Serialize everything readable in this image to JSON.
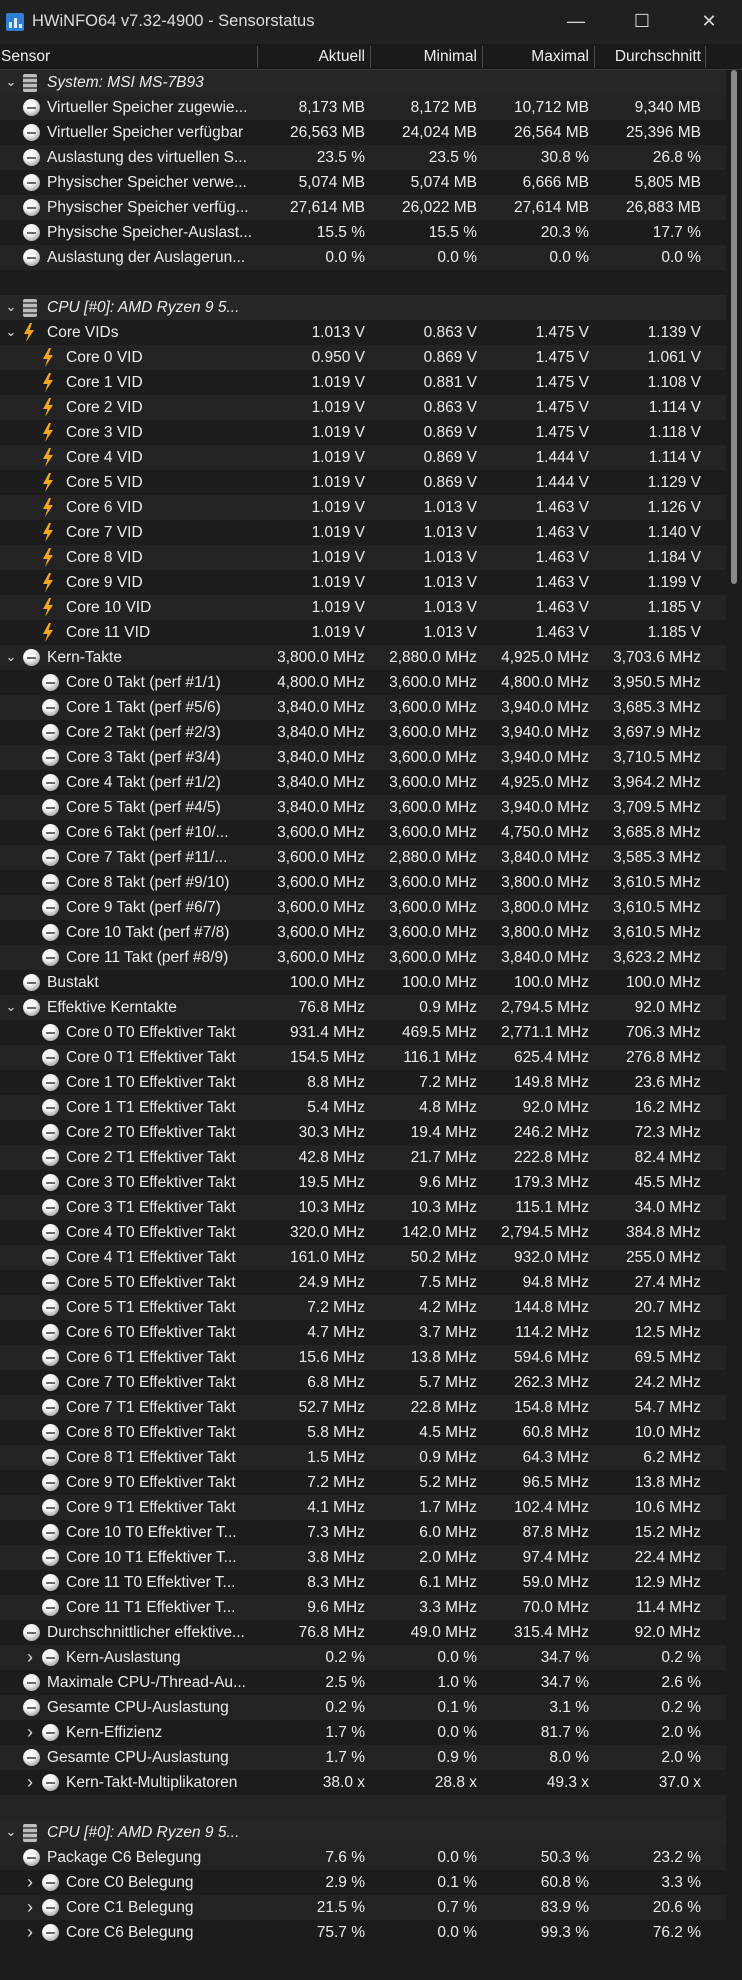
{
  "window": {
    "title": "HWiNFO64 v7.32-4900 - Sensorstatus",
    "minimize_glyph": "—",
    "maximize_glyph": "☐",
    "close_glyph": "✕",
    "icon": "hwinfo-app-icon"
  },
  "columns": {
    "sensor": "Sensor",
    "current": "Aktuell",
    "min": "Minimal",
    "max": "Maximal",
    "avg": "Durchschnitt"
  },
  "icons": {
    "expanded": "chevron-down-icon",
    "collapsed": "chevron-right-icon",
    "group": "chip-icon",
    "voltage": "lightning-bolt-icon",
    "value": "gauge-icon"
  },
  "colors": {
    "background": "#1c1c1c",
    "row_alt": "#232323",
    "text": "#ededed",
    "bolt": "#f3a81c"
  },
  "rows": [
    {
      "kind": "group",
      "chevron": "down",
      "icon": "chip",
      "level": 0,
      "name": "System: MSI MS-7B93",
      "values": [
        "",
        "",
        "",
        ""
      ]
    },
    {
      "kind": "item",
      "chevron": "none",
      "icon": "circle",
      "level": 0,
      "name": "Virtueller Speicher zugewie...",
      "values": [
        "8,173 MB",
        "8,172 MB",
        "10,712 MB",
        "9,340 MB"
      ]
    },
    {
      "kind": "item",
      "chevron": "none",
      "icon": "circle",
      "level": 0,
      "name": "Virtueller Speicher verfügbar",
      "values": [
        "26,563 MB",
        "24,024 MB",
        "26,564 MB",
        "25,396 MB"
      ]
    },
    {
      "kind": "item",
      "chevron": "none",
      "icon": "circle",
      "level": 0,
      "name": "Auslastung des virtuellen S...",
      "values": [
        "23.5 %",
        "23.5 %",
        "30.8 %",
        "26.8 %"
      ]
    },
    {
      "kind": "item",
      "chevron": "none",
      "icon": "circle",
      "level": 0,
      "name": "Physischer Speicher verwe...",
      "values": [
        "5,074 MB",
        "5,074 MB",
        "6,666 MB",
        "5,805 MB"
      ]
    },
    {
      "kind": "item",
      "chevron": "none",
      "icon": "circle",
      "level": 0,
      "name": "Physischer Speicher verfüg...",
      "values": [
        "27,614 MB",
        "26,022 MB",
        "27,614 MB",
        "26,883 MB"
      ]
    },
    {
      "kind": "item",
      "chevron": "none",
      "icon": "circle",
      "level": 0,
      "name": "Physische Speicher-Auslast...",
      "values": [
        "15.5 %",
        "15.5 %",
        "20.3 %",
        "17.7 %"
      ]
    },
    {
      "kind": "item",
      "chevron": "none",
      "icon": "circle",
      "level": 0,
      "name": "Auslastung der Auslagerun...",
      "values": [
        "0.0 %",
        "0.0 %",
        "0.0 %",
        "0.0 %"
      ]
    },
    {
      "kind": "spacer",
      "chevron": "none",
      "icon": "none",
      "level": 0,
      "name": "",
      "values": [
        "",
        "",
        "",
        ""
      ]
    },
    {
      "kind": "group",
      "chevron": "down",
      "icon": "chip",
      "level": 0,
      "name": "CPU [#0]: AMD Ryzen 9 5...",
      "values": [
        "",
        "",
        "",
        ""
      ]
    },
    {
      "kind": "item",
      "chevron": "down",
      "icon": "bolt",
      "level": 0,
      "name": "Core VIDs",
      "values": [
        "1.013 V",
        "0.863 V",
        "1.475 V",
        "1.139 V"
      ]
    },
    {
      "kind": "item",
      "chevron": "none",
      "icon": "bolt",
      "level": 1,
      "name": "Core 0 VID",
      "values": [
        "0.950 V",
        "0.869 V",
        "1.475 V",
        "1.061 V"
      ]
    },
    {
      "kind": "item",
      "chevron": "none",
      "icon": "bolt",
      "level": 1,
      "name": "Core 1 VID",
      "values": [
        "1.019 V",
        "0.881 V",
        "1.475 V",
        "1.108 V"
      ]
    },
    {
      "kind": "item",
      "chevron": "none",
      "icon": "bolt",
      "level": 1,
      "name": "Core 2 VID",
      "values": [
        "1.019 V",
        "0.863 V",
        "1.475 V",
        "1.114 V"
      ]
    },
    {
      "kind": "item",
      "chevron": "none",
      "icon": "bolt",
      "level": 1,
      "name": "Core 3 VID",
      "values": [
        "1.019 V",
        "0.869 V",
        "1.475 V",
        "1.118 V"
      ]
    },
    {
      "kind": "item",
      "chevron": "none",
      "icon": "bolt",
      "level": 1,
      "name": "Core 4 VID",
      "values": [
        "1.019 V",
        "0.869 V",
        "1.444 V",
        "1.114 V"
      ]
    },
    {
      "kind": "item",
      "chevron": "none",
      "icon": "bolt",
      "level": 1,
      "name": "Core 5 VID",
      "values": [
        "1.019 V",
        "0.869 V",
        "1.444 V",
        "1.129 V"
      ]
    },
    {
      "kind": "item",
      "chevron": "none",
      "icon": "bolt",
      "level": 1,
      "name": "Core 6 VID",
      "values": [
        "1.019 V",
        "1.013 V",
        "1.463 V",
        "1.126 V"
      ]
    },
    {
      "kind": "item",
      "chevron": "none",
      "icon": "bolt",
      "level": 1,
      "name": "Core 7 VID",
      "values": [
        "1.019 V",
        "1.013 V",
        "1.463 V",
        "1.140 V"
      ]
    },
    {
      "kind": "item",
      "chevron": "none",
      "icon": "bolt",
      "level": 1,
      "name": "Core 8 VID",
      "values": [
        "1.019 V",
        "1.013 V",
        "1.463 V",
        "1.184 V"
      ]
    },
    {
      "kind": "item",
      "chevron": "none",
      "icon": "bolt",
      "level": 1,
      "name": "Core 9 VID",
      "values": [
        "1.019 V",
        "1.013 V",
        "1.463 V",
        "1.199 V"
      ]
    },
    {
      "kind": "item",
      "chevron": "none",
      "icon": "bolt",
      "level": 1,
      "name": "Core 10 VID",
      "values": [
        "1.019 V",
        "1.013 V",
        "1.463 V",
        "1.185 V"
      ]
    },
    {
      "kind": "item",
      "chevron": "none",
      "icon": "bolt",
      "level": 1,
      "name": "Core 11 VID",
      "values": [
        "1.019 V",
        "1.013 V",
        "1.463 V",
        "1.185 V"
      ]
    },
    {
      "kind": "item",
      "chevron": "down",
      "icon": "circle",
      "level": 0,
      "name": "Kern-Takte",
      "values": [
        "3,800.0 MHz",
        "2,880.0 MHz",
        "4,925.0 MHz",
        "3,703.6 MHz"
      ]
    },
    {
      "kind": "item",
      "chevron": "none",
      "icon": "circle",
      "level": 1,
      "name": "Core 0 Takt (perf #1/1)",
      "values": [
        "4,800.0 MHz",
        "3,600.0 MHz",
        "4,800.0 MHz",
        "3,950.5 MHz"
      ]
    },
    {
      "kind": "item",
      "chevron": "none",
      "icon": "circle",
      "level": 1,
      "name": "Core 1 Takt (perf #5/6)",
      "values": [
        "3,840.0 MHz",
        "3,600.0 MHz",
        "3,940.0 MHz",
        "3,685.3 MHz"
      ]
    },
    {
      "kind": "item",
      "chevron": "none",
      "icon": "circle",
      "level": 1,
      "name": "Core 2 Takt (perf #2/3)",
      "values": [
        "3,840.0 MHz",
        "3,600.0 MHz",
        "3,940.0 MHz",
        "3,697.9 MHz"
      ]
    },
    {
      "kind": "item",
      "chevron": "none",
      "icon": "circle",
      "level": 1,
      "name": "Core 3 Takt (perf #3/4)",
      "values": [
        "3,840.0 MHz",
        "3,600.0 MHz",
        "3,940.0 MHz",
        "3,710.5 MHz"
      ]
    },
    {
      "kind": "item",
      "chevron": "none",
      "icon": "circle",
      "level": 1,
      "name": "Core 4 Takt (perf #1/2)",
      "values": [
        "3,840.0 MHz",
        "3,600.0 MHz",
        "4,925.0 MHz",
        "3,964.2 MHz"
      ]
    },
    {
      "kind": "item",
      "chevron": "none",
      "icon": "circle",
      "level": 1,
      "name": "Core 5 Takt (perf #4/5)",
      "values": [
        "3,840.0 MHz",
        "3,600.0 MHz",
        "3,940.0 MHz",
        "3,709.5 MHz"
      ]
    },
    {
      "kind": "item",
      "chevron": "none",
      "icon": "circle",
      "level": 1,
      "name": "Core 6 Takt (perf #10/...",
      "values": [
        "3,600.0 MHz",
        "3,600.0 MHz",
        "4,750.0 MHz",
        "3,685.8 MHz"
      ]
    },
    {
      "kind": "item",
      "chevron": "none",
      "icon": "circle",
      "level": 1,
      "name": "Core 7 Takt (perf #11/...",
      "values": [
        "3,600.0 MHz",
        "2,880.0 MHz",
        "3,840.0 MHz",
        "3,585.3 MHz"
      ]
    },
    {
      "kind": "item",
      "chevron": "none",
      "icon": "circle",
      "level": 1,
      "name": "Core 8 Takt (perf #9/10)",
      "values": [
        "3,600.0 MHz",
        "3,600.0 MHz",
        "3,800.0 MHz",
        "3,610.5 MHz"
      ]
    },
    {
      "kind": "item",
      "chevron": "none",
      "icon": "circle",
      "level": 1,
      "name": "Core 9 Takt (perf #6/7)",
      "values": [
        "3,600.0 MHz",
        "3,600.0 MHz",
        "3,800.0 MHz",
        "3,610.5 MHz"
      ]
    },
    {
      "kind": "item",
      "chevron": "none",
      "icon": "circle",
      "level": 1,
      "name": "Core 10 Takt (perf #7/8)",
      "values": [
        "3,600.0 MHz",
        "3,600.0 MHz",
        "3,800.0 MHz",
        "3,610.5 MHz"
      ]
    },
    {
      "kind": "item",
      "chevron": "none",
      "icon": "circle",
      "level": 1,
      "name": "Core 11 Takt (perf #8/9)",
      "values": [
        "3,600.0 MHz",
        "3,600.0 MHz",
        "3,840.0 MHz",
        "3,623.2 MHz"
      ]
    },
    {
      "kind": "item",
      "chevron": "none",
      "icon": "circle",
      "level": 0,
      "name": "Bustakt",
      "values": [
        "100.0 MHz",
        "100.0 MHz",
        "100.0 MHz",
        "100.0 MHz"
      ]
    },
    {
      "kind": "item",
      "chevron": "down",
      "icon": "circle",
      "level": 0,
      "name": "Effektive Kerntakte",
      "values": [
        "76.8 MHz",
        "0.9 MHz",
        "2,794.5 MHz",
        "92.0 MHz"
      ]
    },
    {
      "kind": "item",
      "chevron": "none",
      "icon": "circle",
      "level": 1,
      "name": "Core 0 T0 Effektiver Takt",
      "values": [
        "931.4 MHz",
        "469.5 MHz",
        "2,771.1 MHz",
        "706.3 MHz"
      ]
    },
    {
      "kind": "item",
      "chevron": "none",
      "icon": "circle",
      "level": 1,
      "name": "Core 0 T1 Effektiver Takt",
      "values": [
        "154.5 MHz",
        "116.1 MHz",
        "625.4 MHz",
        "276.8 MHz"
      ]
    },
    {
      "kind": "item",
      "chevron": "none",
      "icon": "circle",
      "level": 1,
      "name": "Core 1 T0 Effektiver Takt",
      "values": [
        "8.8 MHz",
        "7.2 MHz",
        "149.8 MHz",
        "23.6 MHz"
      ]
    },
    {
      "kind": "item",
      "chevron": "none",
      "icon": "circle",
      "level": 1,
      "name": "Core 1 T1 Effektiver Takt",
      "values": [
        "5.4 MHz",
        "4.8 MHz",
        "92.0 MHz",
        "16.2 MHz"
      ]
    },
    {
      "kind": "item",
      "chevron": "none",
      "icon": "circle",
      "level": 1,
      "name": "Core 2 T0 Effektiver Takt",
      "values": [
        "30.3 MHz",
        "19.4 MHz",
        "246.2 MHz",
        "72.3 MHz"
      ]
    },
    {
      "kind": "item",
      "chevron": "none",
      "icon": "circle",
      "level": 1,
      "name": "Core 2 T1 Effektiver Takt",
      "values": [
        "42.8 MHz",
        "21.7 MHz",
        "222.8 MHz",
        "82.4 MHz"
      ]
    },
    {
      "kind": "item",
      "chevron": "none",
      "icon": "circle",
      "level": 1,
      "name": "Core 3 T0 Effektiver Takt",
      "values": [
        "19.5 MHz",
        "9.6 MHz",
        "179.3 MHz",
        "45.5 MHz"
      ]
    },
    {
      "kind": "item",
      "chevron": "none",
      "icon": "circle",
      "level": 1,
      "name": "Core 3 T1 Effektiver Takt",
      "values": [
        "10.3 MHz",
        "10.3 MHz",
        "115.1 MHz",
        "34.0 MHz"
      ]
    },
    {
      "kind": "item",
      "chevron": "none",
      "icon": "circle",
      "level": 1,
      "name": "Core 4 T0 Effektiver Takt",
      "values": [
        "320.0 MHz",
        "142.0 MHz",
        "2,794.5 MHz",
        "384.8 MHz"
      ]
    },
    {
      "kind": "item",
      "chevron": "none",
      "icon": "circle",
      "level": 1,
      "name": "Core 4 T1 Effektiver Takt",
      "values": [
        "161.0 MHz",
        "50.2 MHz",
        "932.0 MHz",
        "255.0 MHz"
      ]
    },
    {
      "kind": "item",
      "chevron": "none",
      "icon": "circle",
      "level": 1,
      "name": "Core 5 T0 Effektiver Takt",
      "values": [
        "24.9 MHz",
        "7.5 MHz",
        "94.8 MHz",
        "27.4 MHz"
      ]
    },
    {
      "kind": "item",
      "chevron": "none",
      "icon": "circle",
      "level": 1,
      "name": "Core 5 T1 Effektiver Takt",
      "values": [
        "7.2 MHz",
        "4.2 MHz",
        "144.8 MHz",
        "20.7 MHz"
      ]
    },
    {
      "kind": "item",
      "chevron": "none",
      "icon": "circle",
      "level": 1,
      "name": "Core 6 T0 Effektiver Takt",
      "values": [
        "4.7 MHz",
        "3.7 MHz",
        "114.2 MHz",
        "12.5 MHz"
      ]
    },
    {
      "kind": "item",
      "chevron": "none",
      "icon": "circle",
      "level": 1,
      "name": "Core 6 T1 Effektiver Takt",
      "values": [
        "15.6 MHz",
        "13.8 MHz",
        "594.6 MHz",
        "69.5 MHz"
      ]
    },
    {
      "kind": "item",
      "chevron": "none",
      "icon": "circle",
      "level": 1,
      "name": "Core 7 T0 Effektiver Takt",
      "values": [
        "6.8 MHz",
        "5.7 MHz",
        "262.3 MHz",
        "24.2 MHz"
      ]
    },
    {
      "kind": "item",
      "chevron": "none",
      "icon": "circle",
      "level": 1,
      "name": "Core 7 T1 Effektiver Takt",
      "values": [
        "52.7 MHz",
        "22.8 MHz",
        "154.8 MHz",
        "54.7 MHz"
      ]
    },
    {
      "kind": "item",
      "chevron": "none",
      "icon": "circle",
      "level": 1,
      "name": "Core 8 T0 Effektiver Takt",
      "values": [
        "5.8 MHz",
        "4.5 MHz",
        "60.8 MHz",
        "10.0 MHz"
      ]
    },
    {
      "kind": "item",
      "chevron": "none",
      "icon": "circle",
      "level": 1,
      "name": "Core 8 T1 Effektiver Takt",
      "values": [
        "1.5 MHz",
        "0.9 MHz",
        "64.3 MHz",
        "6.2 MHz"
      ]
    },
    {
      "kind": "item",
      "chevron": "none",
      "icon": "circle",
      "level": 1,
      "name": "Core 9 T0 Effektiver Takt",
      "values": [
        "7.2 MHz",
        "5.2 MHz",
        "96.5 MHz",
        "13.8 MHz"
      ]
    },
    {
      "kind": "item",
      "chevron": "none",
      "icon": "circle",
      "level": 1,
      "name": "Core 9 T1 Effektiver Takt",
      "values": [
        "4.1 MHz",
        "1.7 MHz",
        "102.4 MHz",
        "10.6 MHz"
      ]
    },
    {
      "kind": "item",
      "chevron": "none",
      "icon": "circle",
      "level": 1,
      "name": "Core 10 T0 Effektiver T...",
      "values": [
        "7.3 MHz",
        "6.0 MHz",
        "87.8 MHz",
        "15.2 MHz"
      ]
    },
    {
      "kind": "item",
      "chevron": "none",
      "icon": "circle",
      "level": 1,
      "name": "Core 10 T1 Effektiver T...",
      "values": [
        "3.8 MHz",
        "2.0 MHz",
        "97.4 MHz",
        "22.4 MHz"
      ]
    },
    {
      "kind": "item",
      "chevron": "none",
      "icon": "circle",
      "level": 1,
      "name": "Core 11 T0 Effektiver T...",
      "values": [
        "8.3 MHz",
        "6.1 MHz",
        "59.0 MHz",
        "12.9 MHz"
      ]
    },
    {
      "kind": "item",
      "chevron": "none",
      "icon": "circle",
      "level": 1,
      "name": "Core 11 T1 Effektiver T...",
      "values": [
        "9.6 MHz",
        "3.3 MHz",
        "70.0 MHz",
        "11.4 MHz"
      ]
    },
    {
      "kind": "item",
      "chevron": "none",
      "icon": "circle",
      "level": 0,
      "name": "Durchschnittlicher effektive...",
      "values": [
        "76.8 MHz",
        "49.0 MHz",
        "315.4 MHz",
        "92.0 MHz"
      ]
    },
    {
      "kind": "item",
      "chevron": "right",
      "icon": "circle",
      "level": 1,
      "name": "Kern-Auslastung",
      "values": [
        "0.2 %",
        "0.0 %",
        "34.7 %",
        "0.2 %"
      ]
    },
    {
      "kind": "item",
      "chevron": "none",
      "icon": "circle",
      "level": 0,
      "name": "Maximale CPU-/Thread-Au...",
      "values": [
        "2.5 %",
        "1.0 %",
        "34.7 %",
        "2.6 %"
      ]
    },
    {
      "kind": "item",
      "chevron": "none",
      "icon": "circle",
      "level": 0,
      "name": "Gesamte CPU-Auslastung",
      "values": [
        "0.2 %",
        "0.1 %",
        "3.1 %",
        "0.2 %"
      ]
    },
    {
      "kind": "item",
      "chevron": "right",
      "icon": "circle",
      "level": 1,
      "name": "Kern-Effizienz",
      "values": [
        "1.7 %",
        "0.0 %",
        "81.7 %",
        "2.0 %"
      ]
    },
    {
      "kind": "item",
      "chevron": "none",
      "icon": "circle",
      "level": 0,
      "name": "Gesamte CPU-Auslastung",
      "values": [
        "1.7 %",
        "0.9 %",
        "8.0 %",
        "2.0 %"
      ]
    },
    {
      "kind": "item",
      "chevron": "right",
      "icon": "circle",
      "level": 1,
      "name": "Kern-Takt-Multiplikatoren",
      "values": [
        "38.0 x",
        "28.8 x",
        "49.3 x",
        "37.0 x"
      ]
    },
    {
      "kind": "spacer",
      "chevron": "none",
      "icon": "none",
      "level": 0,
      "name": "",
      "values": [
        "",
        "",
        "",
        ""
      ]
    },
    {
      "kind": "group",
      "chevron": "down",
      "icon": "chip",
      "level": 0,
      "name": "CPU [#0]: AMD Ryzen 9 5...",
      "values": [
        "",
        "",
        "",
        ""
      ]
    },
    {
      "kind": "item",
      "chevron": "none",
      "icon": "circle",
      "level": 0,
      "name": "Package C6 Belegung",
      "values": [
        "7.6 %",
        "0.0 %",
        "50.3 %",
        "23.2 %"
      ]
    },
    {
      "kind": "item",
      "chevron": "right",
      "icon": "circle",
      "level": 1,
      "name": "Core C0 Belegung",
      "values": [
        "2.9 %",
        "0.1 %",
        "60.8 %",
        "3.3 %"
      ]
    },
    {
      "kind": "item",
      "chevron": "right",
      "icon": "circle",
      "level": 1,
      "name": "Core C1 Belegung",
      "values": [
        "21.5 %",
        "0.7 %",
        "83.9 %",
        "20.6 %"
      ]
    },
    {
      "kind": "item",
      "chevron": "right",
      "icon": "circle",
      "level": 1,
      "name": "Core C6 Belegung",
      "values": [
        "75.7 %",
        "0.0 %",
        "99.3 %",
        "76.2 %"
      ]
    }
  ]
}
